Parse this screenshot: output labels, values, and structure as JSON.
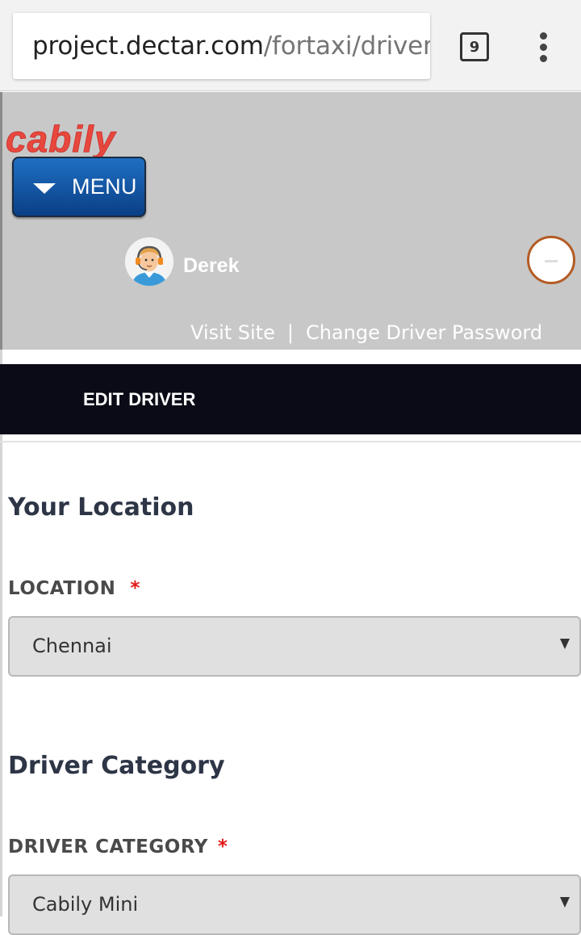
{
  "browser": {
    "url_domain": "project.dectar.com",
    "url_path": "/fortaxi/driver/",
    "tab_count": "9",
    "menu_icon": "kebab-menu-icon"
  },
  "header": {
    "logo_text": "cabily",
    "logo_color": "#e8473e",
    "menu_label": "MENU",
    "user_name": "Derek",
    "links": {
      "visit_site": "Visit Site",
      "separator": "|",
      "change_password": "Change Driver Password"
    }
  },
  "page": {
    "title": "EDIT DRIVER"
  },
  "form": {
    "location_section": {
      "heading": "Your Location",
      "label": "LOCATION",
      "required_mark": "*",
      "value": "Chennai"
    },
    "category_section": {
      "heading": "Driver Category",
      "label": "DRIVER CATEGORY",
      "required_mark": "*",
      "value": "Cabily Mini"
    }
  }
}
